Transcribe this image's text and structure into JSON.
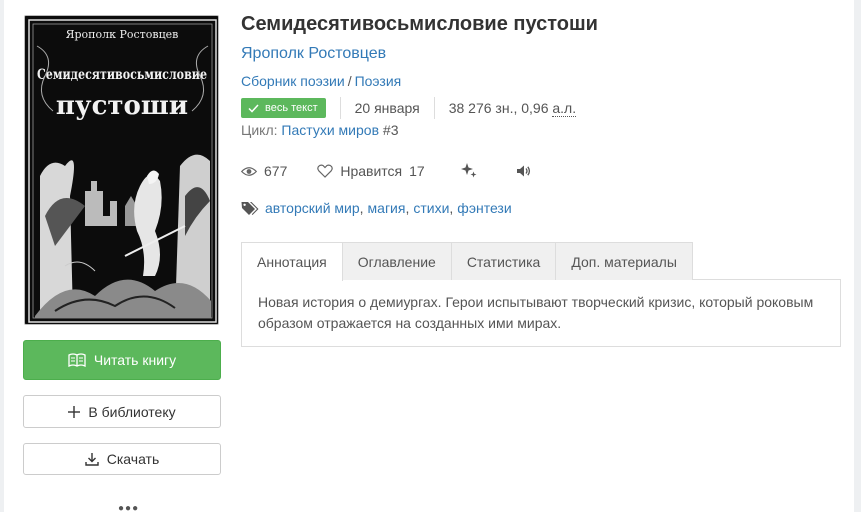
{
  "book": {
    "title": "Семидесятивосьмисловие пустоши",
    "author": "Ярополк Ростовцев",
    "category": "Сборник поэзии",
    "genre_sep": "/",
    "genre": "Поэзия",
    "badge": "весь текст",
    "date": "20 января",
    "size_chars": "38 276 зн., 0,96 ",
    "size_unit": "а.л.",
    "cycle_label": "Цикл:",
    "cycle_name": "Пастухи миров",
    "cycle_num": "#3"
  },
  "cover": {
    "author_text": "Ярополк Ростовцев",
    "title_line1": "Семидесятивосьмисловие",
    "title_line2": "пустоши"
  },
  "stats": {
    "views": "677",
    "likes_label": "Нравится",
    "likes": "17"
  },
  "tags": [
    "авторский мир",
    "магия",
    "стихи",
    "фэнтези"
  ],
  "tag_comma": ",",
  "tabs": [
    {
      "label": "Аннотация"
    },
    {
      "label": "Оглавление"
    },
    {
      "label": "Статистика"
    },
    {
      "label": "Доп. материалы"
    }
  ],
  "annotation": "Новая история о демиургах. Герои испытывают творческий кризис, который роковым образом отражается на созданных ими мирах.",
  "actions": {
    "read": "Читать книгу",
    "library": "В библиотеку",
    "download": "Скачать",
    "more": "●●●"
  },
  "colors": {
    "accent": "#5cb85c",
    "link": "#337ab7"
  }
}
